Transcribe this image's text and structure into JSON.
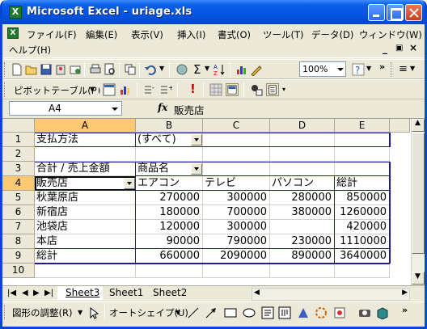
{
  "window": {
    "title": "Microsoft Excel - uriage.xls",
    "app_icon_letter": "X"
  },
  "menu": {
    "items": [
      "ファイル(F)",
      "編集(E)",
      "表示(V)",
      "挿入(I)",
      "書式(O)",
      "ツール(T)",
      "データ(D)",
      "ウィンドウ(W)",
      "ヘルプ(H)"
    ]
  },
  "toolbar": {
    "zoom": "100%",
    "pivot_label": "ピボットテーブル(P)"
  },
  "formula_bar": {
    "name_box": "A4",
    "fx": "fx",
    "value": "販売店"
  },
  "columns": [
    "A",
    "B",
    "C",
    "D",
    "E"
  ],
  "rows": [
    "1",
    "2",
    "3",
    "4",
    "5",
    "6",
    "7",
    "8",
    "9",
    "10"
  ],
  "cells": {
    "A1": "支払方法",
    "B1": "(すべて)",
    "A3": "合計 / 売上金額",
    "B3": "商品名",
    "A4": "販売店",
    "B4": "エアコン",
    "C4": "テレビ",
    "D4": "パソコン",
    "E4": "総計",
    "A5": "秋葉原店",
    "B5": "270000",
    "C5": "300000",
    "D5": "280000",
    "E5": "850000",
    "A6": "新宿店",
    "B6": "180000",
    "C6": "700000",
    "D6": "380000",
    "E6": "1260000",
    "A7": "池袋店",
    "B7": "120000",
    "C7": "300000",
    "D7": "",
    "E7": "420000",
    "A8": "本店",
    "B8": "90000",
    "C8": "790000",
    "D8": "230000",
    "E8": "1110000",
    "A9": "総計",
    "B9": "660000",
    "C9": "2090000",
    "D9": "890000",
    "E9": "3640000"
  },
  "sheets": [
    "Sheet3",
    "Sheet1",
    "Sheet2"
  ],
  "drawing": {
    "adjust_label": "図形の調整(R)",
    "autoshape_label": "オートシェイプ(U)"
  },
  "colors": {
    "title_blue": "#0a5ee8",
    "pivot_border": "#1a1a9a",
    "selected_header": "#ffc873",
    "excel_green": "#1e7a2c"
  }
}
